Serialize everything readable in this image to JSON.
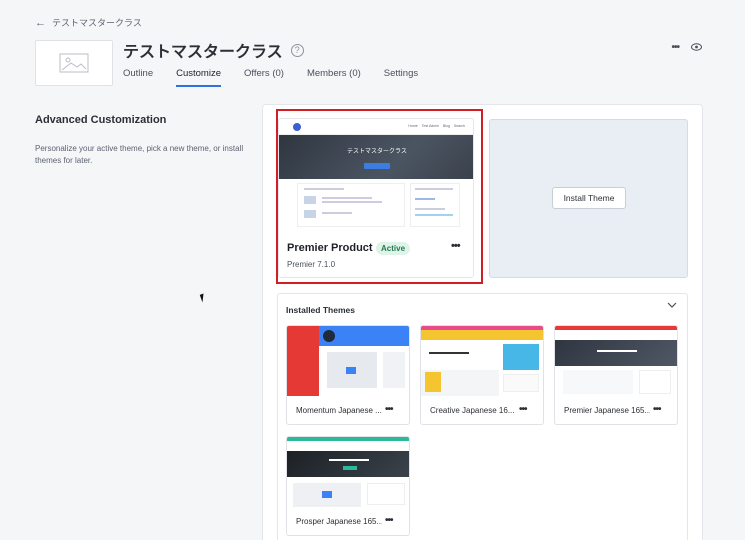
{
  "header": {
    "back_label": "テストマスタークラス",
    "title": "テストマスタークラス",
    "help_icon": "?",
    "tabs": [
      {
        "label": "Outline",
        "active": false
      },
      {
        "label": "Customize",
        "active": true
      },
      {
        "label": "Offers (0)",
        "active": false
      },
      {
        "label": "Members (0)",
        "active": false
      },
      {
        "label": "Settings",
        "active": false
      }
    ],
    "more_icon": "•••",
    "view_icon": "eye-icon"
  },
  "left": {
    "title": "Advanced Customization",
    "description": "Personalize your active theme, pick a new theme, or install themes for later."
  },
  "active_theme": {
    "preview_title": "テストマスタークラス",
    "preview_links": [
      "Home",
      "Test Admin",
      "Blog",
      "Search"
    ],
    "name": "Premier Product",
    "badge": "Active",
    "version": "Premier 7.1.0",
    "menu_icon": "•••"
  },
  "install": {
    "button_label": "Install Theme"
  },
  "installed": {
    "title": "Installed Themes",
    "chevron_icon": "⌵",
    "themes": [
      {
        "name": "Momentum Japanese ...",
        "menu": "•••",
        "accent": "#e53935"
      },
      {
        "name": "Creative Japanese 16...",
        "menu": "•••",
        "accent": "#f4c531"
      },
      {
        "name": "Premier Japanese 165...",
        "menu": "•••",
        "accent": "#e53935"
      },
      {
        "name": "Prosper Japanese 165...",
        "menu": "•••",
        "accent": "#2cb99a"
      }
    ]
  },
  "colors": {
    "accent": "#3070e4",
    "highlight": "#d11f26",
    "active_badge": "#237a52"
  }
}
